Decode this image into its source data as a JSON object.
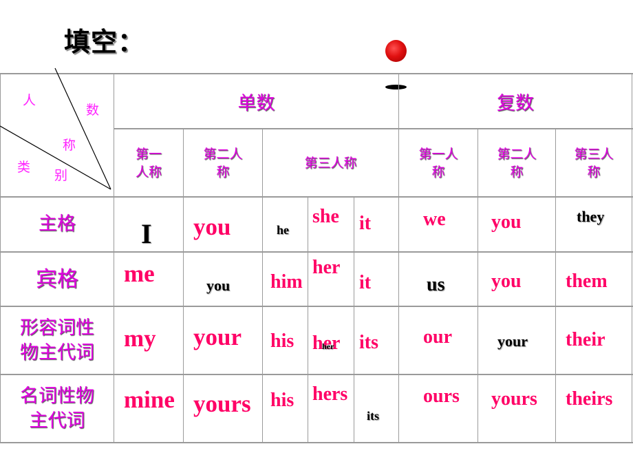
{
  "title": "填空：",
  "decorations": {
    "ball_color": "#e01010",
    "dash_color": "#000000"
  },
  "corner_cell": {
    "labels": [
      "人",
      "数",
      "称",
      "类",
      "别"
    ]
  },
  "groups": [
    {
      "label": "单数"
    },
    {
      "label": "复数"
    }
  ],
  "columns": [
    {
      "label_line1": "第一",
      "label_line2": "人称"
    },
    {
      "label_line1": "第二人",
      "label_line2": "称"
    },
    {
      "label_line1": "第三人称",
      "label_line2": ""
    },
    {
      "label_line1": "第一人",
      "label_line2": "称"
    },
    {
      "label_line1": "第二人",
      "label_line2": "称"
    },
    {
      "label_line1": "第三人",
      "label_line2": "称"
    }
  ],
  "rows": [
    {
      "label_line1": "主格",
      "label_line2": "",
      "cells": {
        "sg1": "I",
        "sg2": "you",
        "he": "he",
        "she": "she",
        "it": "it",
        "pl1": "we",
        "pl2": "you",
        "pl3": "they"
      }
    },
    {
      "label_line1": "宾格",
      "label_line2": "",
      "cells": {
        "sg1": "me",
        "sg2": "you",
        "he": "him",
        "she": "her",
        "it": "it",
        "pl1": "us",
        "pl2": "you",
        "pl3": "them"
      }
    },
    {
      "label_line1": "形容词性",
      "label_line2": "物主代词",
      "cells": {
        "sg1": "my",
        "sg2": "your",
        "he": "his",
        "she": "her",
        "she_overlay": "her",
        "it": "its",
        "pl1": "our",
        "pl2": "your",
        "pl3": "their"
      }
    },
    {
      "label_line1": "名词性物",
      "label_line2": "主代词",
      "cells": {
        "sg1": "mine",
        "sg2": "yours",
        "he": "his",
        "she": "hers",
        "it": "its",
        "pl1": "ours",
        "pl2": "yours",
        "pl3": "theirs"
      }
    }
  ],
  "colors": {
    "answer_pink": "#ff0066",
    "header_magenta": "#e000e0",
    "given_black": "#000000",
    "grid": "#9a9a9a"
  }
}
